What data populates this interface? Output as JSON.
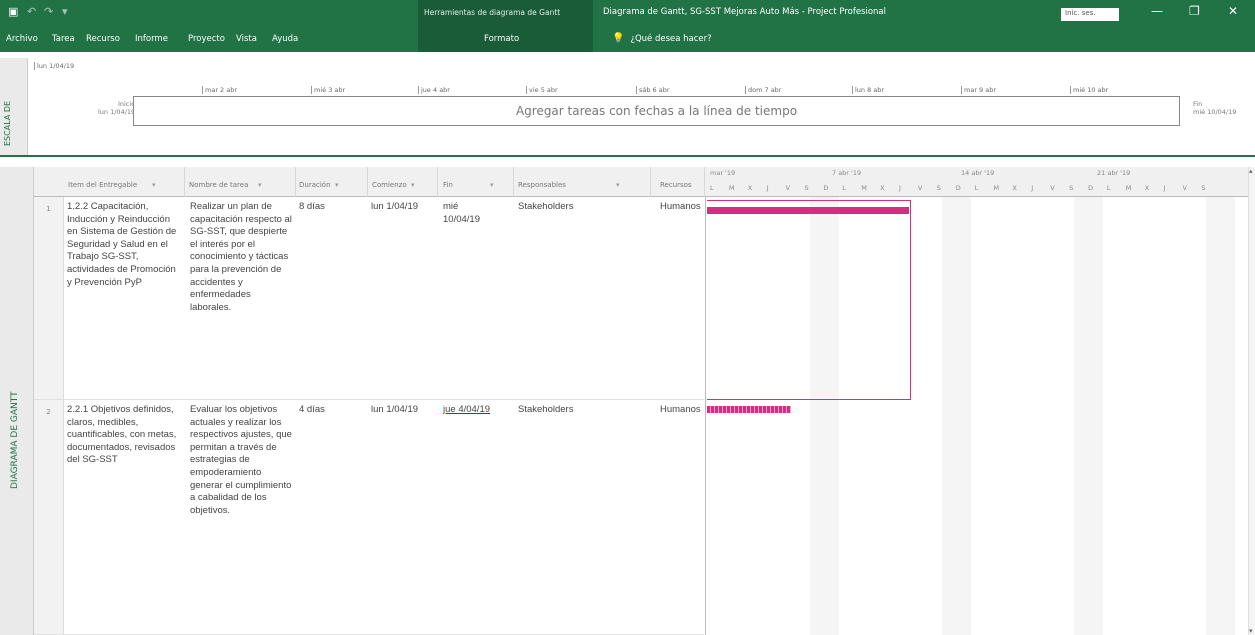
{
  "window": {
    "context_tools": "Herramientas de diagrama de Gantt",
    "title": "Diagrama de Gantt, SG-SST Mejoras Auto Más - Project Profesional",
    "signin": "Inic. ses.",
    "minimize": "—",
    "restore": "❐",
    "close": "✕"
  },
  "quick_access": {
    "save_icon": "▣",
    "undo_icon": "↶",
    "redo_icon": "↷",
    "customize_icon": "▾"
  },
  "ribbon": {
    "tabs": [
      "Archivo",
      "Tarea",
      "Recurso",
      "Informe",
      "Proyecto",
      "Vista",
      "Ayuda"
    ],
    "context_tab": "Formato",
    "tellme_icon": "💡",
    "tellme": "¿Qué desea hacer?"
  },
  "timeline": {
    "side_label": "ESCALA DE",
    "first_date": "lun 1/04/19",
    "ticks": [
      "mar 2 abr",
      "mié 3 abr",
      "jue 4 abr",
      "vie 5 abr",
      "sáb 6 abr",
      "dom 7 abr",
      "lun 8 abr",
      "mar 9 abr",
      "mié 10 abr"
    ],
    "start_label": "Inicio",
    "start_date": "lun 1/04/19",
    "placeholder": "Agregar tareas con fechas a la línea de tiempo",
    "end_label": "Fin",
    "end_date": "mié 10/04/19"
  },
  "gantt_sidebar_label": "DIAGRAMA DE GANTT",
  "columns": [
    "Item del Entregable",
    "Nombre de tarea",
    "Duración",
    "Comienzo",
    "Fin",
    "Responsables",
    "Recursos"
  ],
  "gantt_header": {
    "weeks": [
      "mar '19",
      "7 abr '19",
      "14 abr '19",
      "21 abr '19"
    ],
    "days": [
      "L",
      "M",
      "X",
      "J",
      "V",
      "S",
      "D",
      "L",
      "M",
      "X",
      "J",
      "V",
      "S",
      "D",
      "L",
      "M",
      "X",
      "J",
      "V",
      "S",
      "D",
      "L",
      "M",
      "X",
      "J",
      "V",
      "S"
    ]
  },
  "rows": [
    {
      "num": "1",
      "item": "1.2.2 Capacitación, Inducción y Reinducción en Sistema de Gestión de Seguridad y Salud en el Trabajo SG-SST, actividades de Promoción y Prevención PyP",
      "name": "Realizar un plan de capacitación respecto al SG-SST, que despierte el interés por el conocimiento y tácticas para la prevención de accidentes y enfermedades laborales.",
      "duration": "8 días",
      "start": "lun 1/04/19",
      "end": "mié 10/04/19",
      "responsible": "Stakeholders",
      "resources": "Humanos"
    },
    {
      "num": "2",
      "item": "2.2.1 Objetivos definidos, claros, medibles, cuantificables, con metas, documentados, revisados del SG-SST",
      "name": "Evaluar los objetivos actuales y realizar los respectivos ajustes, que permitan a través de estrategias de empoderamiento generar el cumplimiento a cabalidad de los objetivos.",
      "duration": "4 días",
      "start": "lun 1/04/19",
      "end": "jue 4/04/19",
      "responsible": "Stakeholders",
      "resources": "Humanos"
    }
  ],
  "colors": {
    "accent": "#217346",
    "bar": "#d62d80"
  }
}
